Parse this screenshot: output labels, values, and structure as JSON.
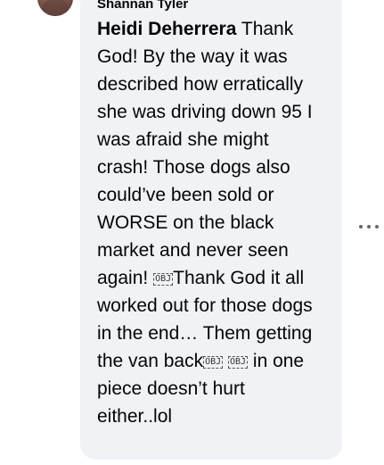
{
  "comment": {
    "author": "Shannan Tyler",
    "mention": "Heidi Deherrera",
    "text_1": " Thank God! By the way it was described how erratically she was driving down 95 I was afraid she might crash! Those dogs also could’ve been sold or WORSE on the black market and never seen again! ",
    "text_2": "Thank God it all worked out for those dogs in the end… Them getting the van back",
    "text_3": " in one piece doesn’t hurt either..lol",
    "object_glyph": "OBJ"
  },
  "actions": {
    "more_icon": "more-horizontal-icon"
  }
}
